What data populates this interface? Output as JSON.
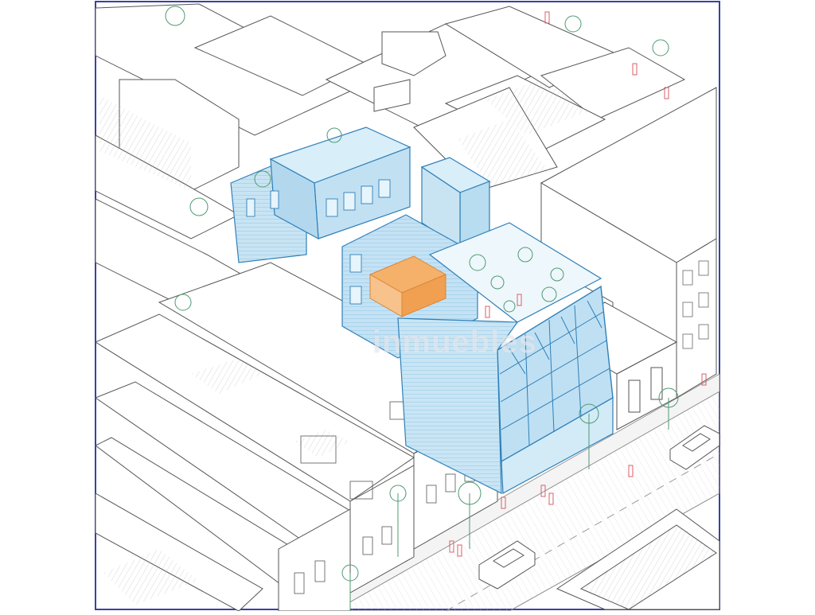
{
  "drawing": {
    "type": "isometric axonometric architectural illustration",
    "watermark_text": "inmuebles",
    "colors": {
      "frame": "#3b3fa8",
      "linework": "#555555",
      "roof_fill": "#ffffff",
      "highlight_glass": "#a9d6ee",
      "highlight_glass_stroke": "#2f7fb8",
      "accent_unit": "#f2a65a",
      "vegetation": "#4f9a73",
      "figures": "#d9606a"
    }
  }
}
